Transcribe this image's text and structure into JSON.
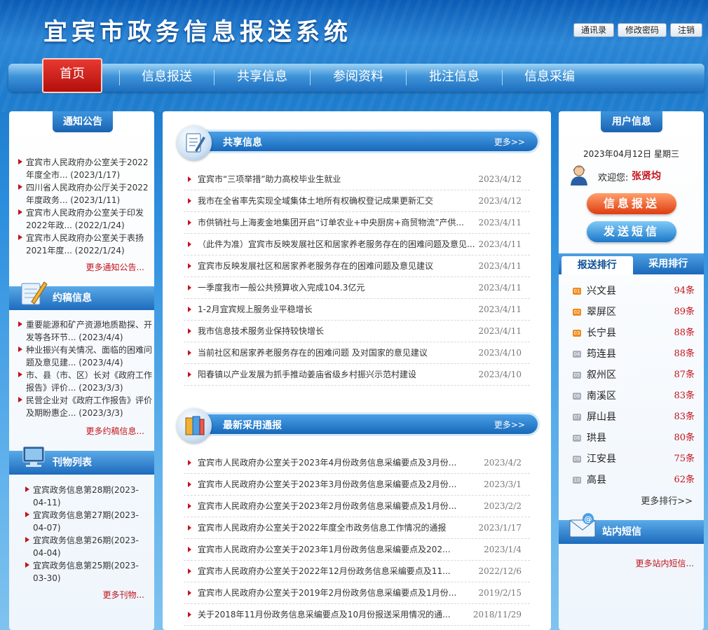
{
  "header": {
    "title": "宜宾市政务信息报送系统",
    "links": [
      "通讯录",
      "修改密码",
      "注销"
    ]
  },
  "nav": {
    "items": [
      "首页",
      "信息报送",
      "共享信息",
      "参阅资料",
      "批注信息",
      "信息采编"
    ],
    "active": 0
  },
  "notice": {
    "title": "通知公告",
    "items": [
      "宜宾市人民政府办公室关于2022年度全市... (2023/1/17)",
      "四川省人民政府办公厅关于2022年度政务... (2023/1/11)",
      "宜宾市人民政府办公室关于印发2022年政... (2022/1/24)",
      "宜宾市人民政府办公室关于表扬2021年度... (2022/1/24)"
    ],
    "more": "更多通知公告..."
  },
  "draft": {
    "title": "约稿信息",
    "items": [
      "重要能源和矿产资源地质勘探、开发等各环节... (2023/4/4)",
      "种业振兴有关情况、面临的困难问题及意见建... (2023/4/4)",
      "市、县（市、区）长对《政府工作报告》评价... (2023/3/3)",
      "民营企业对《政府工作报告》评价及期盼惠企... (2023/3/3)"
    ],
    "more": "更多约稿信息..."
  },
  "periodicals": {
    "title": "刊物列表",
    "items": [
      "宜宾政务信息第28期(2023-04-11)",
      "宜宾政务信息第27期(2023-04-07)",
      "宜宾政务信息第26期(2023-04-04)",
      "宜宾政务信息第25期(2023-03-30)"
    ],
    "more": "更多刊物..."
  },
  "shared": {
    "title": "共享信息",
    "more": "更多>>",
    "items": [
      {
        "t": "宜宾市“三项举措”助力高校毕业生就业",
        "d": "2023/4/12"
      },
      {
        "t": "我市在全省率先实现全域集体土地所有权确权登记成果更新汇交",
        "d": "2023/4/12"
      },
      {
        "t": "市供销社与上海麦金地集团开启“订单农业+中央厨房+商贸物流”产供...",
        "d": "2023/4/11"
      },
      {
        "t": "（此件为准）宜宾市反映发展社区和居家养老服务存在的困难问题及意见...",
        "d": "2023/4/11"
      },
      {
        "t": "宜宾市反映发展社区和居家养老服务存在的困难问题及意见建议",
        "d": "2023/4/11"
      },
      {
        "t": "一季度我市一般公共预算收入完成104.3亿元",
        "d": "2023/4/11"
      },
      {
        "t": "1-2月宜宾规上服务业平稳增长",
        "d": "2023/4/11"
      },
      {
        "t": "我市信息技术服务业保持较快增长",
        "d": "2023/4/11"
      },
      {
        "t": "当前社区和居家养老服务存在的困难问题 及对国家的意见建议",
        "d": "2023/4/10"
      },
      {
        "t": "阳春镇以产业发展为抓手推动姜庙省级乡村振兴示范村建设",
        "d": "2023/4/10"
      }
    ]
  },
  "adopted": {
    "title": "最新采用通报",
    "more": "更多>>",
    "items": [
      {
        "t": "宜宾市人民政府办公室关于2023年4月份政务信息采编要点及3月份...",
        "d": "2023/4/2"
      },
      {
        "t": "宜宾市人民政府办公室关于2023年3月份政务信息采编要点及2月份...",
        "d": "2023/3/1"
      },
      {
        "t": "宜宾市人民政府办公室关于2023年2月份政务信息采编要点及1月份...",
        "d": "2023/2/2"
      },
      {
        "t": "宜宾市人民政府办公室关于2022年度全市政务信息工作情况的通报",
        "d": "2023/1/17"
      },
      {
        "t": "宜宾市人民政府办公室关于2023年1月份政务信息采编要点及202...",
        "d": "2023/1/4"
      },
      {
        "t": "宜宾市人民政府办公室关于2022年12月份政务信息采编要点及11...",
        "d": "2022/12/6"
      },
      {
        "t": "宜宾市人民政府办公室关于2019年2月份政务信息采编要点及1月份...",
        "d": "2019/2/15"
      },
      {
        "t": "关于2018年11月份政务信息采编要点及10月份报送采用情况的通...",
        "d": "2018/11/29"
      }
    ]
  },
  "user": {
    "title": "用户信息",
    "date": "2023年04月12日 星期三",
    "welcome": "欢迎您:",
    "name": "张贤均",
    "report_btn": "信息报送",
    "sms_btn": "发送短信"
  },
  "ranking": {
    "tabs": [
      "报送排行",
      "采用排行"
    ],
    "items": [
      {
        "n": "01",
        "name": "兴文县",
        "c": "94条"
      },
      {
        "n": "02",
        "name": "翠屏区",
        "c": "89条"
      },
      {
        "n": "03",
        "name": "长宁县",
        "c": "88条"
      },
      {
        "n": "04",
        "name": "筠连县",
        "c": "88条"
      },
      {
        "n": "05",
        "name": "叙州区",
        "c": "87条"
      },
      {
        "n": "06",
        "name": "南溪区",
        "c": "83条"
      },
      {
        "n": "07",
        "name": "屏山县",
        "c": "83条"
      },
      {
        "n": "08",
        "name": "珙县",
        "c": "80条"
      },
      {
        "n": "09",
        "name": "江安县",
        "c": "75条"
      },
      {
        "n": "10",
        "name": "高县",
        "c": "62条"
      }
    ],
    "more": "更多排行>>"
  },
  "messages": {
    "title": "站内短信",
    "more": "更多站内短信..."
  },
  "colors": {
    "accent_red": "#c3131b",
    "brand_blue": "#1a63b3"
  }
}
